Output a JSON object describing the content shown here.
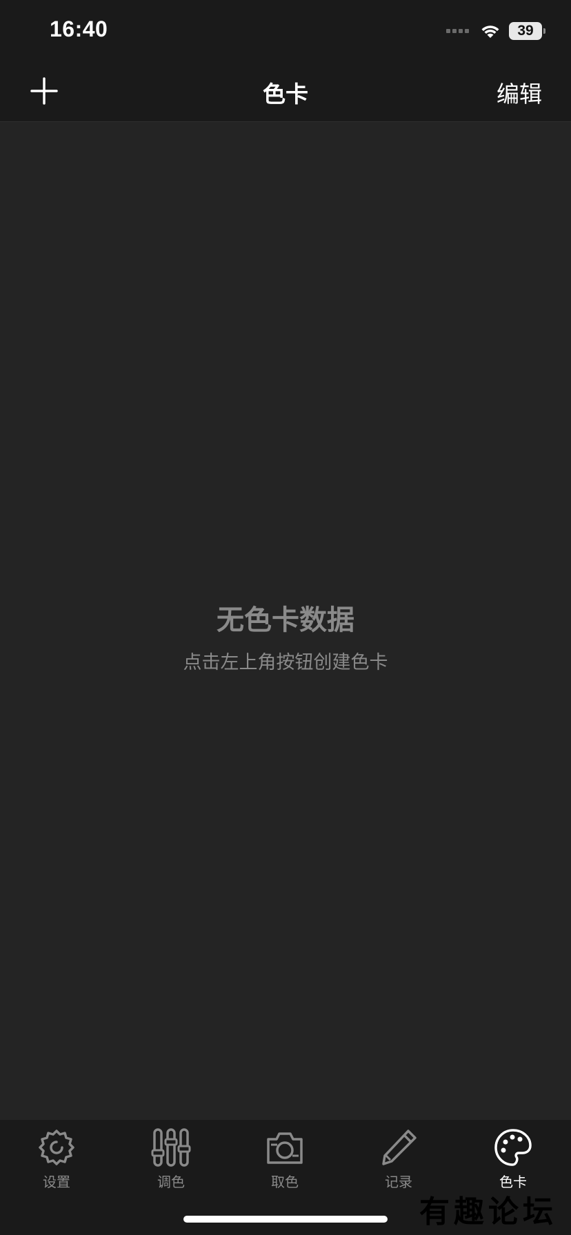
{
  "status_bar": {
    "time": "16:40",
    "battery": "39"
  },
  "nav": {
    "title": "色卡",
    "edit_label": "编辑"
  },
  "empty_state": {
    "title": "无色卡数据",
    "subtitle": "点击左上角按钮创建色卡"
  },
  "tabs": [
    {
      "label": "设置",
      "icon": "gear-icon"
    },
    {
      "label": "调色",
      "icon": "sliders-icon"
    },
    {
      "label": "取色",
      "icon": "camera-icon"
    },
    {
      "label": "记录",
      "icon": "pencil-icon"
    },
    {
      "label": "色卡",
      "icon": "palette-icon",
      "active": true
    }
  ],
  "watermark": "有趣论坛",
  "colors": {
    "background": "#1a1a1a",
    "content": "#242424",
    "inactive": "#8a8a8a",
    "active": "#ffffff"
  }
}
